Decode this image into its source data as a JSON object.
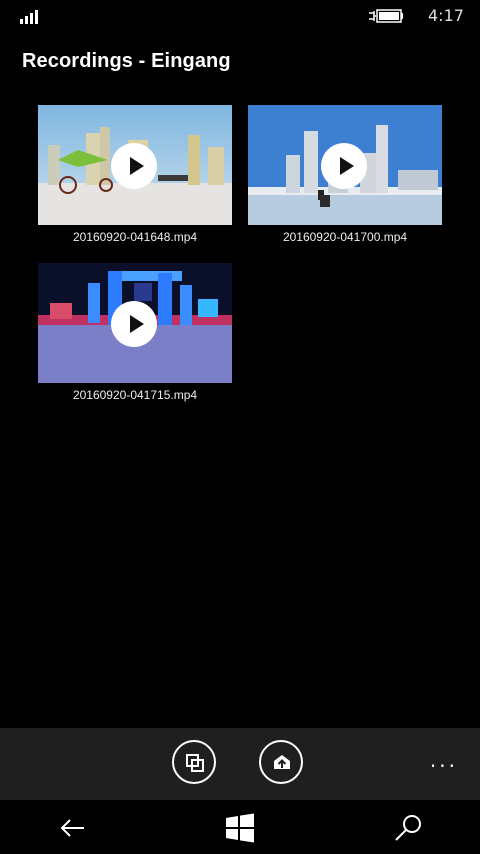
{
  "status": {
    "time": "4:17"
  },
  "header": {
    "title": "Recordings - Eingang"
  },
  "recordings": [
    {
      "filename": "20160920-041648.mp4"
    },
    {
      "filename": "20160920-041700.mp4"
    },
    {
      "filename": "20160920-041715.mp4"
    }
  ],
  "app_bar": {
    "more_label": "..."
  }
}
